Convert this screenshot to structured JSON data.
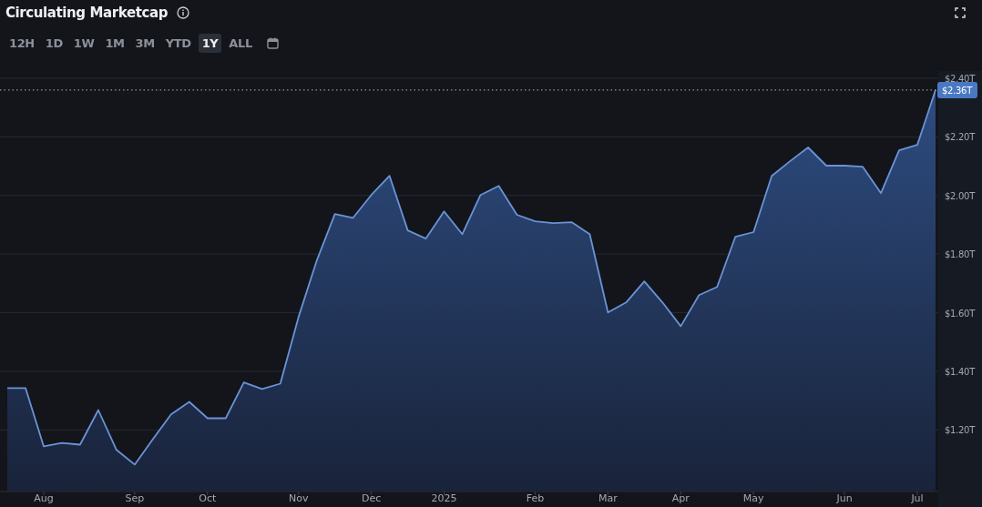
{
  "title": "Circulating Marketcap",
  "range_tabs": [
    {
      "label": "12H",
      "selected": false
    },
    {
      "label": "1D",
      "selected": false
    },
    {
      "label": "1W",
      "selected": false
    },
    {
      "label": "1M",
      "selected": false
    },
    {
      "label": "3M",
      "selected": false
    },
    {
      "label": "YTD",
      "selected": false
    },
    {
      "label": "1Y",
      "selected": true
    },
    {
      "label": "ALL",
      "selected": false
    }
  ],
  "chart_data": {
    "type": "area",
    "categories": [
      null,
      null,
      "Aug",
      null,
      null,
      null,
      null,
      "Sep",
      null,
      null,
      null,
      "Oct",
      null,
      null,
      null,
      null,
      "Nov",
      null,
      null,
      null,
      "Dec",
      null,
      null,
      null,
      "2025",
      null,
      null,
      null,
      null,
      "Feb",
      null,
      null,
      null,
      "Mar",
      null,
      null,
      null,
      "Apr",
      null,
      null,
      null,
      "May",
      null,
      null,
      null,
      null,
      "Jun",
      null,
      null,
      null,
      "Jul",
      null
    ],
    "series": [
      {
        "color": "#6b93d6",
        "values": [
          1.343,
          1.343,
          1.144,
          1.156,
          1.15,
          1.268,
          1.132,
          1.082,
          1.169,
          1.253,
          1.296,
          1.24,
          1.24,
          1.362,
          1.34,
          1.358,
          1.585,
          1.778,
          1.937,
          1.924,
          2.002,
          2.067,
          1.881,
          1.853,
          1.946,
          1.868,
          2.002,
          2.033,
          1.934,
          1.912,
          1.906,
          1.909,
          1.868,
          1.601,
          1.635,
          1.707,
          1.635,
          1.554,
          1.66,
          1.688,
          1.859,
          1.875,
          2.067,
          2.117,
          2.164,
          2.102,
          2.102,
          2.098,
          2.008,
          2.154,
          2.173,
          2.36
        ]
      }
    ],
    "ylim": [
      0.99,
      2.4
    ],
    "yticks": [
      {
        "value": 1.2,
        "label": "$1.20T"
      },
      {
        "value": 1.4,
        "label": "$1.40T"
      },
      {
        "value": 1.6,
        "label": "$1.60T"
      },
      {
        "value": 1.8,
        "label": "$1.80T"
      },
      {
        "value": 2.0,
        "label": "$2.00T"
      },
      {
        "value": 2.2,
        "label": "$2.20T"
      },
      {
        "value": 2.4,
        "label": "$2.40T"
      }
    ],
    "grid": true,
    "ref_lines": [
      {
        "axis": "y",
        "value": 2.36,
        "label": "$2.36T"
      }
    ]
  }
}
